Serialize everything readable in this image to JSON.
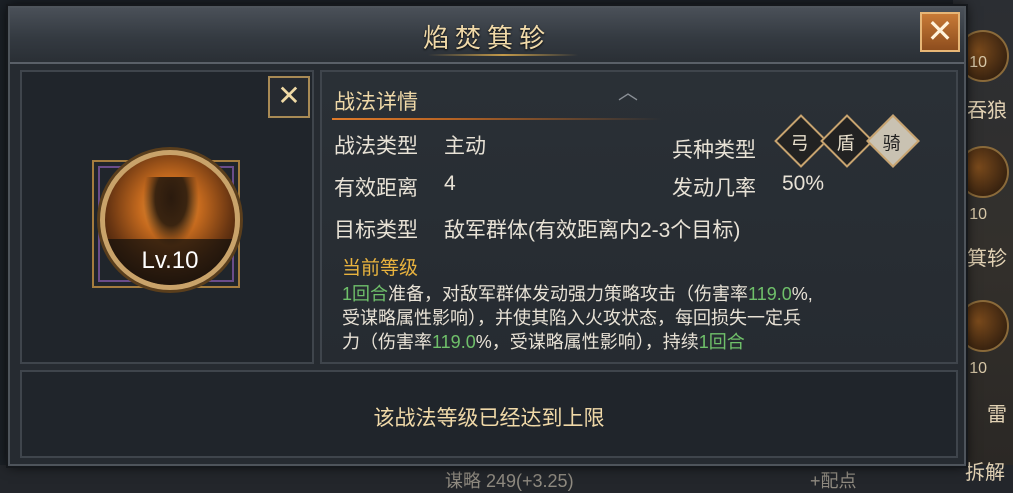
{
  "background": {
    "right_items": [
      {
        "num": "10",
        "label": "吞狼"
      },
      {
        "num": "10",
        "label": "箕轸"
      },
      {
        "num": "10",
        "label": "雷"
      }
    ],
    "bottom_left": "谋略 249(+3.25)",
    "bottom_right": "+配点",
    "bottom_far_right": "拆解"
  },
  "dialog": {
    "title": "焰焚箕轸",
    "close_icon": "close-icon"
  },
  "skill": {
    "level": "Lv.10",
    "close_icon": "close-icon"
  },
  "details": {
    "section_title": "战法详情",
    "type_label": "战法类型",
    "type_value": "主动",
    "troop_label": "兵种类型",
    "troop_icons": [
      {
        "name": "archer-troop-icon",
        "glyph": "弓",
        "active": false
      },
      {
        "name": "infantry-troop-icon",
        "glyph": "盾",
        "active": false
      },
      {
        "name": "cavalry-troop-icon",
        "glyph": "骑",
        "active": true
      }
    ],
    "range_label": "有效距离",
    "range_value": "4",
    "rate_label": "发动几率",
    "rate_value": "50%",
    "target_label": "目标类型",
    "target_value": "敌军群体(有效距离内2-3个目标)",
    "current_level_title": "当前等级",
    "desc_line1_hl1": "1回合",
    "desc_line1_text": "准备，对敌军群体发动强力策略攻击（伤害率",
    "desc_line1_hl2": "119.0",
    "desc_line1_end": "%,",
    "desc_line2": "受谋略属性影响），并使其陷入火攻状态，每回损失一定兵",
    "desc_line3_start": "力（伤害率",
    "desc_line3_hl1": "119.0",
    "desc_line3_mid": "%，受谋略属性影响），持续",
    "desc_line3_hl2": "1回合"
  },
  "status": {
    "message": "该战法等级已经达到上限"
  },
  "colors": {
    "accent_gold": "#f0d9a8",
    "highlight_green": "#6fc06a",
    "title_orange": "#e9b33e",
    "close_orange": "#c87a36"
  }
}
